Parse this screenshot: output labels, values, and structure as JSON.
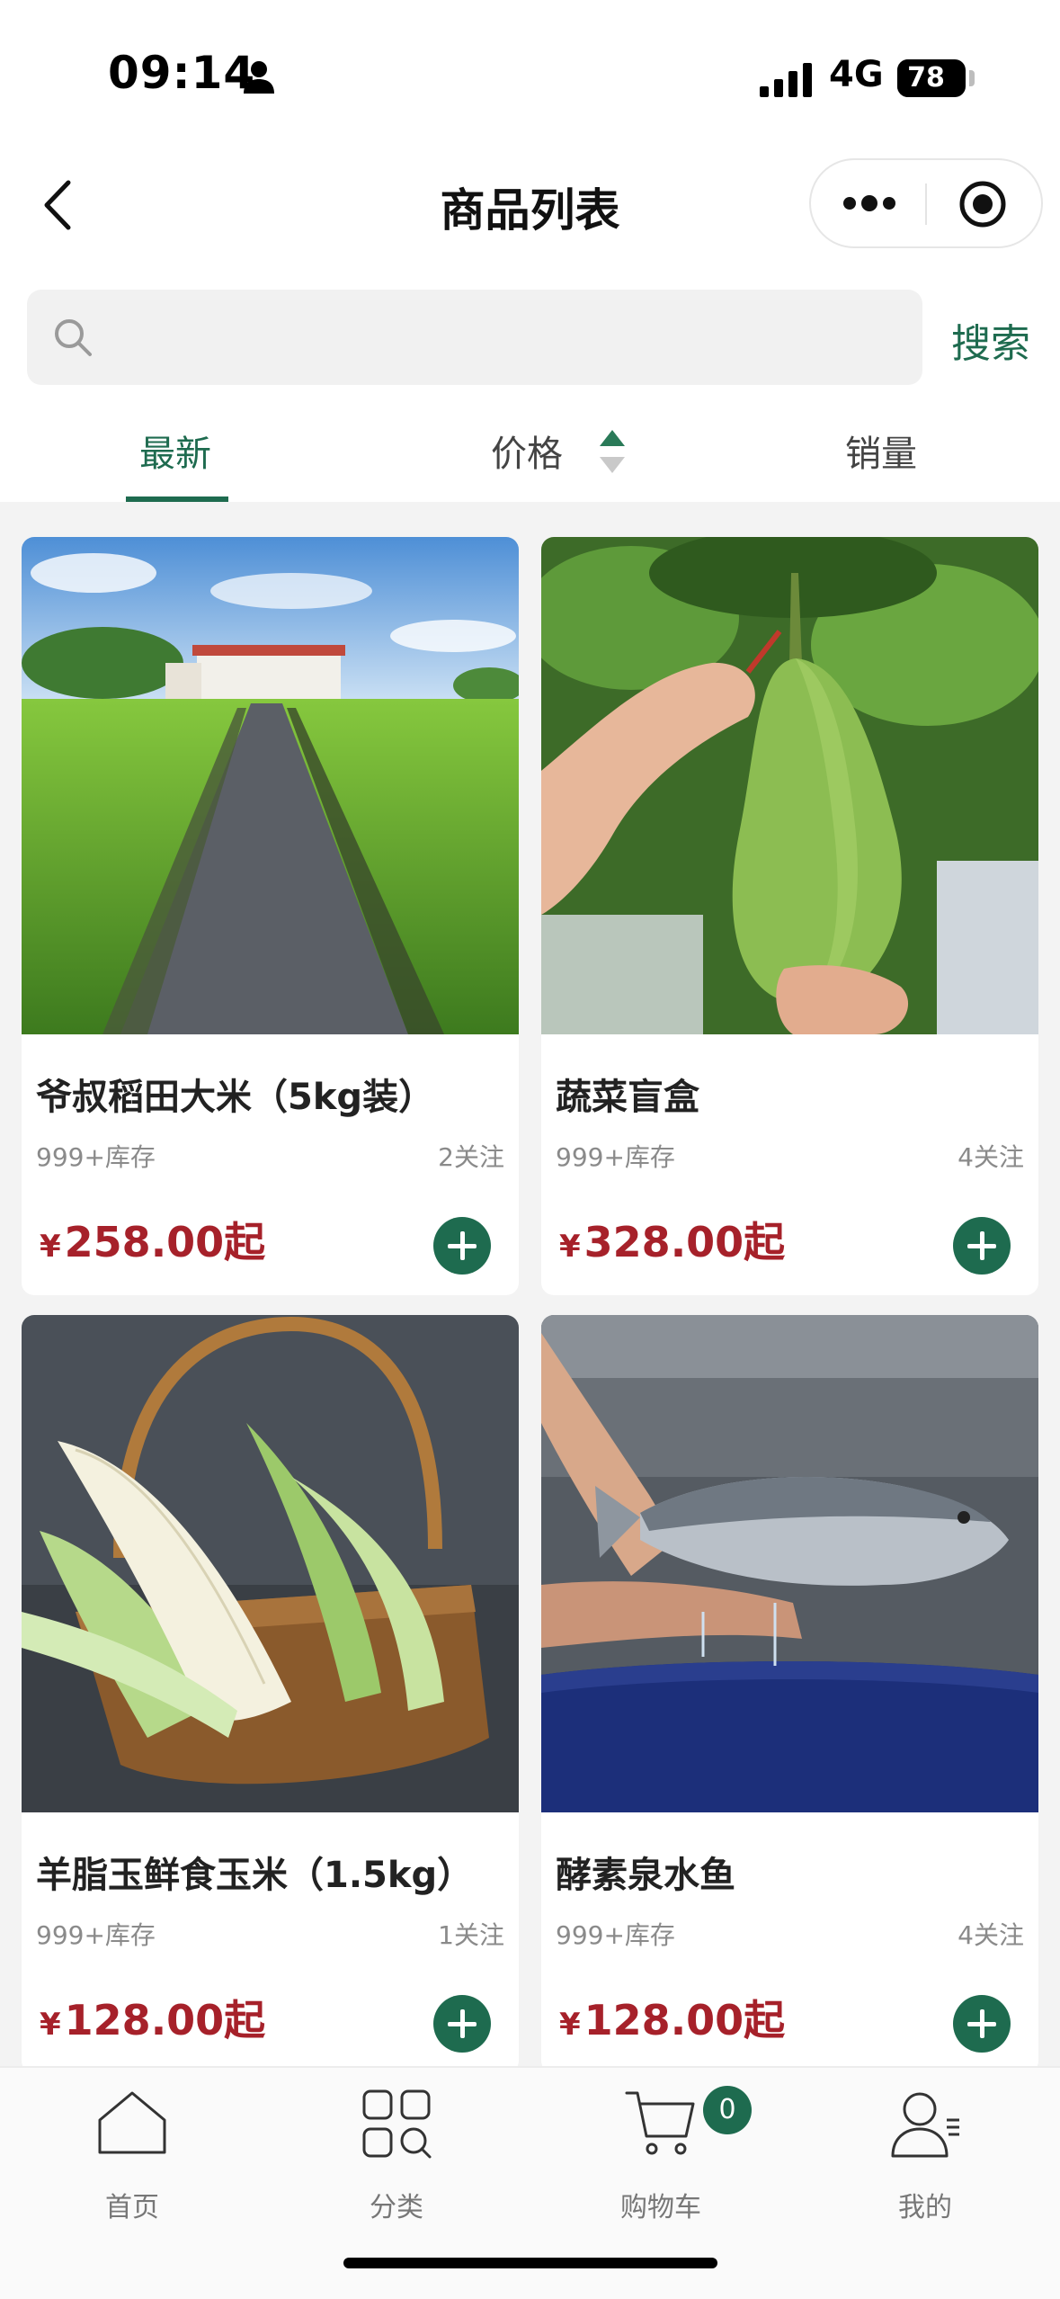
{
  "status_bar": {
    "time": "09:14",
    "network": "4G",
    "battery": "78",
    "battery_level": 78
  },
  "nav": {
    "title": "商品列表"
  },
  "search": {
    "placeholder": "",
    "button_label": "搜索"
  },
  "sort_tabs": {
    "latest": "最新",
    "price": "价格",
    "sales": "销量"
  },
  "products": [
    {
      "name": "爷叔稻田大米（5kg装）",
      "stock": "999+库存",
      "follows": "2关注",
      "currency": "¥",
      "price": "258.00起",
      "image": "rice-paddy-photo"
    },
    {
      "name": "蔬菜盲盒",
      "stock": "999+库存",
      "follows": "4关注",
      "currency": "¥",
      "price": "328.00起",
      "image": "winter-melon-photo"
    },
    {
      "name": "羊脂玉鲜食玉米（1.5kg）",
      "stock": "999+库存",
      "follows": "1关注",
      "currency": "¥",
      "price": "128.00起",
      "image": "white-corn-basket-photo"
    },
    {
      "name": "酵素泉水鱼",
      "stock": "999+库存",
      "follows": "4关注",
      "currency": "¥",
      "price": "128.00起",
      "image": "fish-in-hands-photo"
    }
  ],
  "tab_bar": {
    "home": "首页",
    "category": "分类",
    "cart": "购物车",
    "cart_count": "0",
    "mine": "我的"
  },
  "colors": {
    "accent": "#1e6b4f",
    "price": "#a6212a"
  }
}
